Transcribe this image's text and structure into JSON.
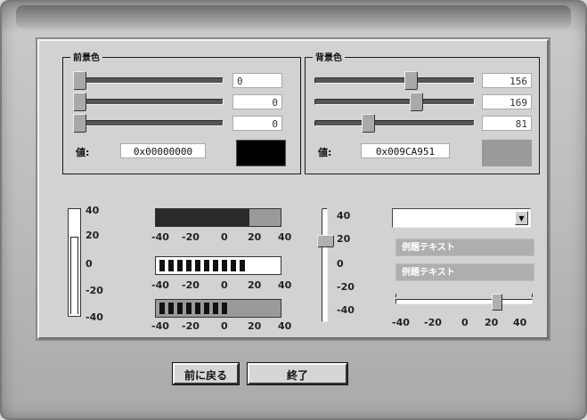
{
  "window": {
    "title": ""
  },
  "foreground": {
    "title": "前景色",
    "values": [
      "0",
      "0",
      "0"
    ],
    "value_label": "値:",
    "hex": "0x00000000",
    "swatch_color": "#000000"
  },
  "background": {
    "title": "背景色",
    "values": [
      "156",
      "169",
      "81"
    ],
    "value_label": "値:",
    "hex": "0x009CA951",
    "swatch_color": "#9a9a9a"
  },
  "vgauge": {
    "ticks": [
      "40",
      "20",
      "0",
      "-20",
      "-40"
    ],
    "level_fraction": 0.72
  },
  "hbars": {
    "ticks": [
      "-40",
      "-20",
      "0",
      "20",
      "40"
    ],
    "bar1_fraction": 0.75,
    "bar2_segments": 10,
    "bar3_segments": 8
  },
  "vslider": {
    "ticks": [
      "40",
      "20",
      "0",
      "-20",
      "-40"
    ],
    "value": 20
  },
  "combo": {
    "value": "",
    "arrow": "▼"
  },
  "text_fields": [
    "例題テキスト",
    "例題テキスト"
  ],
  "hslider2": {
    "ticks": [
      "-40",
      "-20",
      "0",
      "20",
      "40"
    ],
    "value": 20
  },
  "buttons": {
    "back": "前に戻る",
    "exit": "終了"
  },
  "icons": {
    "dropdown": "chevron-down-icon"
  }
}
